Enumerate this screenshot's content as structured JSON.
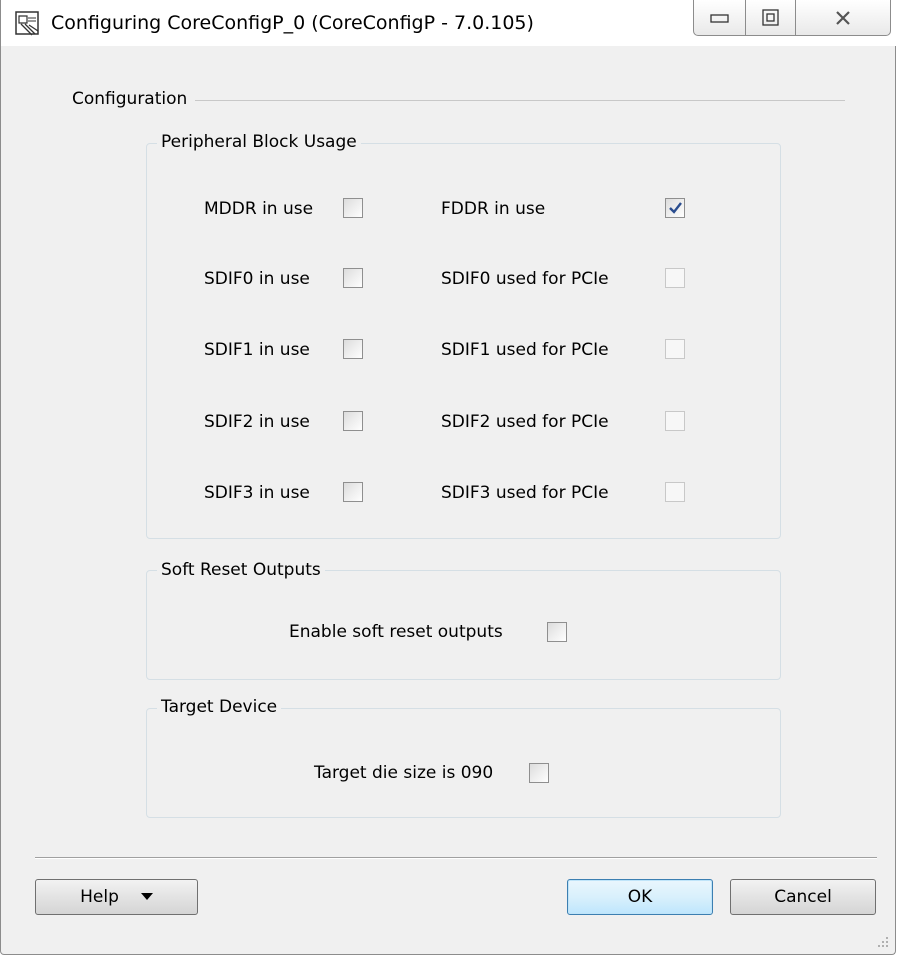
{
  "window": {
    "title": "Configuring CoreConfigP_0 (CoreConfigP - 7.0.105)"
  },
  "config": {
    "legend": "Configuration"
  },
  "peripheral": {
    "legend": "Peripheral Block Usage",
    "mddr_label": "MDDR in use",
    "fddr_label": "FDDR in use",
    "sdif0_label": "SDIF0 in use",
    "sdif0_pcie_label": "SDIF0 used for PCIe",
    "sdif1_label": "SDIF1 in use",
    "sdif1_pcie_label": "SDIF1 used for PCIe",
    "sdif2_label": "SDIF2 in use",
    "sdif2_pcie_label": "SDIF2 used for PCIe",
    "sdif3_label": "SDIF3 in use",
    "sdif3_pcie_label": "SDIF3 used for PCIe"
  },
  "soft_reset": {
    "legend": "Soft Reset Outputs",
    "enable_label": "Enable soft reset outputs"
  },
  "target": {
    "legend": "Target Device",
    "die_label": "Target die size is 090"
  },
  "buttons": {
    "help": "Help",
    "ok": "OK",
    "cancel": "Cancel"
  }
}
